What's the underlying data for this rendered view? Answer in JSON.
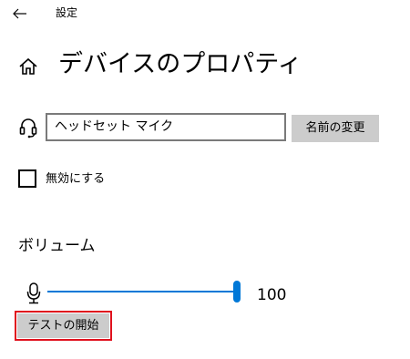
{
  "window": {
    "title": "設定"
  },
  "page": {
    "title": "デバイスのプロパティ"
  },
  "device_name": {
    "value": "ヘッドセット マイク",
    "rename_label": "名前の変更"
  },
  "disable": {
    "label": "無効にする",
    "checked": false
  },
  "volume": {
    "heading": "ボリューム",
    "value": "100",
    "level_fraction": 1.0,
    "accent_color": "#0078d7"
  },
  "test": {
    "button_label": "テストの開始",
    "highlight_color": "#e0111d"
  },
  "icons": {
    "back": "back-arrow-icon",
    "home": "home-icon",
    "headset": "headset-icon",
    "microphone": "microphone-icon"
  }
}
